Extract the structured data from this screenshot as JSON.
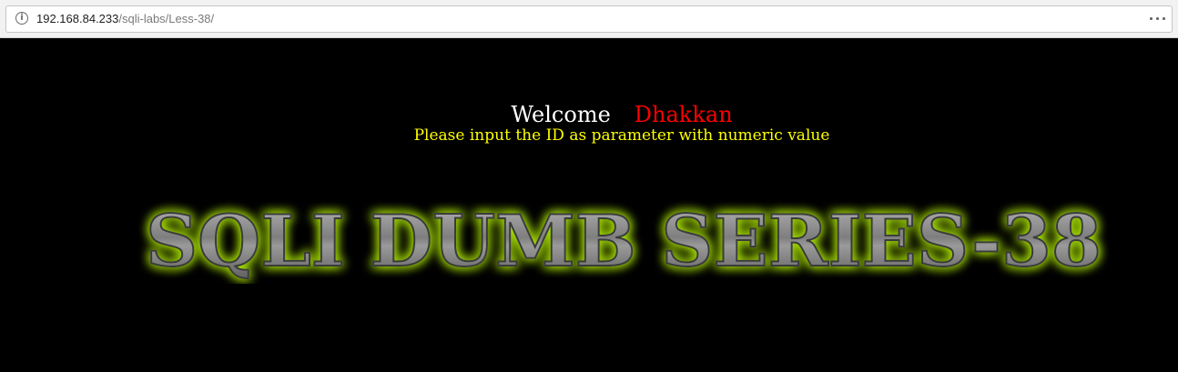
{
  "browser": {
    "url_host": "192.168.84.233",
    "url_path": "/sqli-labs/Less-38/",
    "site_info_icon": "info-circle-icon",
    "menu_icon": "more-horizontal-icon"
  },
  "page": {
    "welcome_word": "Welcome",
    "welcome_name": "Dhakkan",
    "instruction": "Please input the ID as parameter with numeric value",
    "banner_title": "SQLI DUMB SERIES-38"
  },
  "colors": {
    "background": "#000000",
    "welcome_word": "#ffffff",
    "welcome_name": "#ff0000",
    "instruction": "#ffff00",
    "banner_glow": "#a8e000",
    "banner_metal": "#8c8c8c"
  }
}
